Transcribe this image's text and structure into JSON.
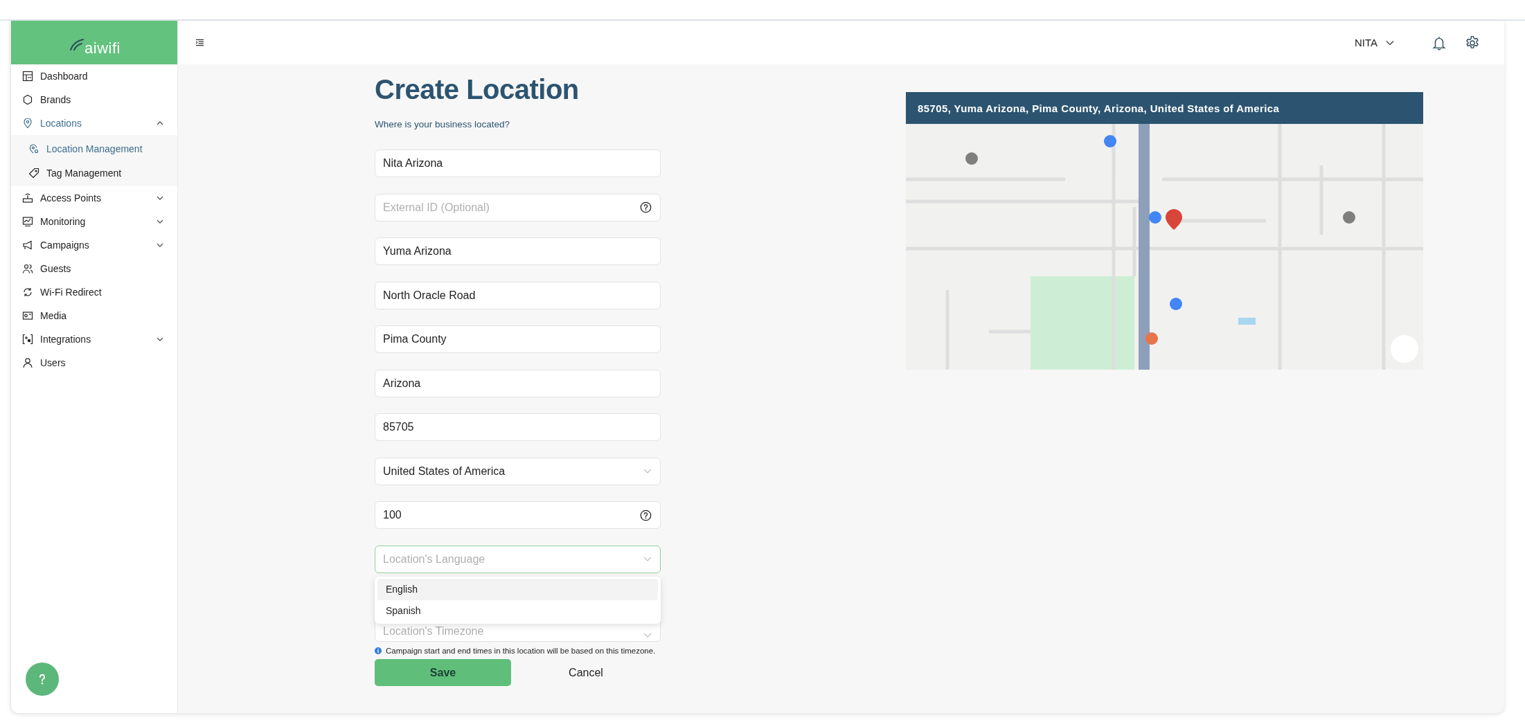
{
  "sidebar": {
    "logo": "aiwifi",
    "items": [
      {
        "label": "Dashboard",
        "selected": false
      },
      {
        "label": "Brands",
        "selected": false
      },
      {
        "label": "Locations",
        "selected": true,
        "expanded": true,
        "children": [
          {
            "label": "Location Management",
            "selected": true
          },
          {
            "label": "Tag Management",
            "selected": false
          }
        ]
      },
      {
        "label": "Access Points",
        "selected": false,
        "expanded": false
      },
      {
        "label": "Monitoring",
        "selected": false,
        "expanded": false
      },
      {
        "label": "Campaigns",
        "selected": false,
        "expanded": false
      },
      {
        "label": "Guests",
        "selected": false
      },
      {
        "label": "Wi-Fi Redirect",
        "selected": false
      },
      {
        "label": "Media",
        "selected": false
      },
      {
        "label": "Integrations",
        "selected": false,
        "expanded": false
      },
      {
        "label": "Users",
        "selected": false
      }
    ]
  },
  "header": {
    "user": "NITA"
  },
  "form": {
    "title": "Create Location",
    "subtitle": "Where is your business located?",
    "fields": [
      {
        "kind": "text",
        "value": "Nita Arizona",
        "focused": false
      },
      {
        "kind": "text",
        "placeholder": "External ID (Optional)",
        "help": true,
        "focused": false
      },
      {
        "kind": "text",
        "value": "Yuma Arizona",
        "focused": false
      },
      {
        "kind": "text",
        "value": "North Oracle Road",
        "focused": false
      },
      {
        "kind": "text",
        "value": "Pima County",
        "focused": false
      },
      {
        "kind": "text",
        "value": "Arizona",
        "focused": false
      },
      {
        "kind": "text",
        "value": "85705",
        "focused": false
      },
      {
        "kind": "select",
        "value": "United States of America",
        "focused": false
      },
      {
        "kind": "text",
        "value": "100",
        "help": true,
        "focused": false
      },
      {
        "kind": "select",
        "placeholder": "Location's Language",
        "focused": true,
        "options": [
          {
            "label": "English",
            "highlighted": true
          },
          {
            "label": "Spanish",
            "highlighted": false
          }
        ]
      },
      {
        "kind": "select",
        "placeholder": "Location's Timezone",
        "focused": false
      }
    ],
    "note": "Campaign start and end times in this location will be based on this timezone.",
    "save": "Save",
    "cancel": "Cancel"
  },
  "map": {
    "address": "85705, Yuma Arizona, Pima County, Arizona, United States of America",
    "kind": "picture"
  }
}
